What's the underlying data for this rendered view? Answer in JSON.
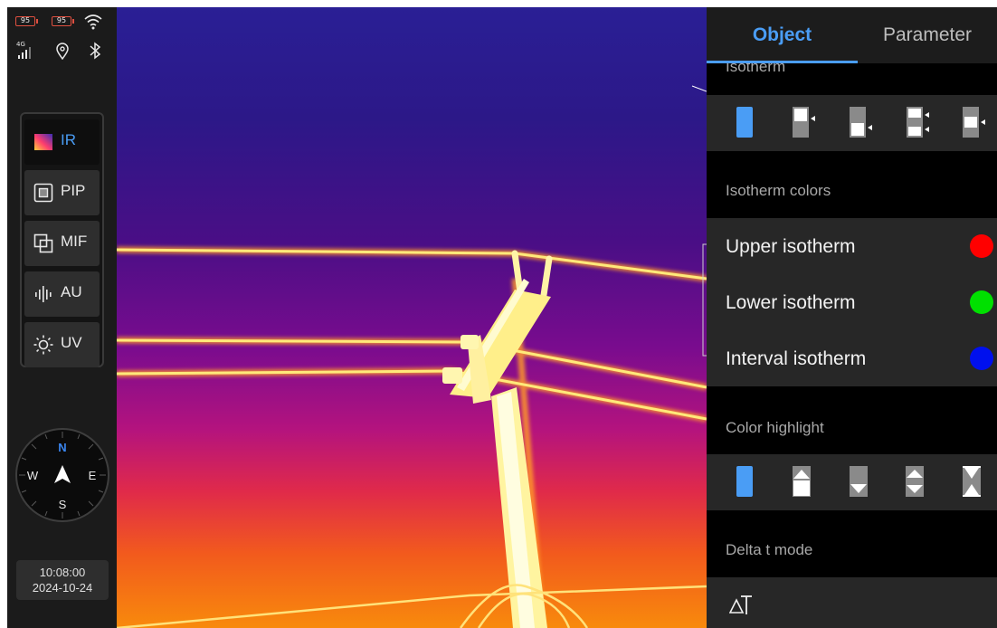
{
  "status": {
    "battery1": "95",
    "battery2": "95",
    "network": "4G"
  },
  "modes": [
    {
      "label": "IR",
      "icon": "ir-gradient-icon",
      "active": true
    },
    {
      "label": "PIP",
      "icon": "pip-icon",
      "active": false
    },
    {
      "label": "MIF",
      "icon": "mif-icon",
      "active": false
    },
    {
      "label": "AU",
      "icon": "audio-waveform-icon",
      "active": false
    },
    {
      "label": "UV",
      "icon": "sun-icon",
      "active": false
    }
  ],
  "compass": {
    "n": "N",
    "s": "S",
    "e": "E",
    "w": "W"
  },
  "clock": {
    "time": "10:08:00",
    "date": "2024-10-24"
  },
  "panel": {
    "tabs": {
      "object": "Object",
      "parameter": "Parameter"
    },
    "isotherm_title": "Isotherm",
    "isotherm_colors_title": "Isotherm colors",
    "color_items": [
      {
        "label": "Upper isotherm",
        "color": "#ff0000"
      },
      {
        "label": "Lower isotherm",
        "color": "#00e000"
      },
      {
        "label": "Interval isotherm",
        "color": "#0010ee"
      }
    ],
    "color_highlight_title": "Color highlight",
    "delta_title": "Delta t mode",
    "delta_icon": "delta-t-icon"
  },
  "colors": {
    "accent": "#4a9df5",
    "panel_bg": "#272727"
  }
}
